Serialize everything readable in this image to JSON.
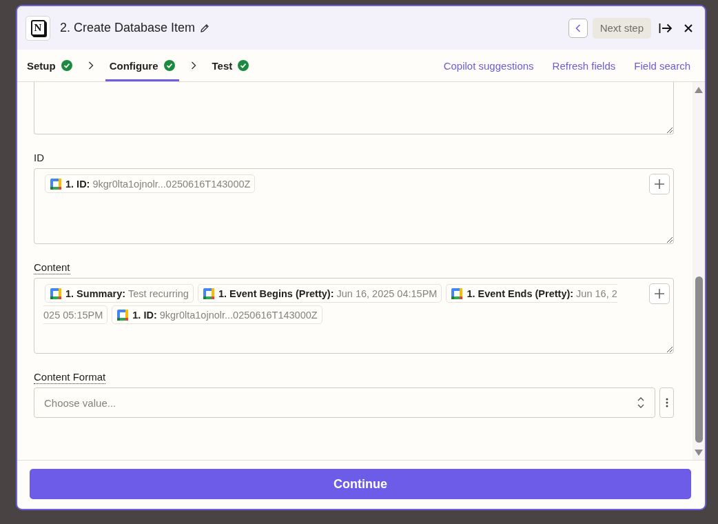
{
  "header": {
    "logo_text": "N",
    "title": "2. Create Database Item",
    "next_button": {
      "label": "Next step",
      "disabled": true
    }
  },
  "steps": [
    {
      "label": "Setup",
      "done": true,
      "selected": false
    },
    {
      "label": "Configure",
      "done": true,
      "selected": true
    },
    {
      "label": "Test",
      "done": true,
      "selected": false
    }
  ],
  "links": [
    "Copilot suggestions",
    "Refresh fields",
    "Field search"
  ],
  "fields": [
    {
      "kind": "textarea",
      "cut_top": true
    },
    {
      "kind": "textarea",
      "cut_top": false,
      "label": "ID",
      "has_tooltip": false,
      "token_lines": [
        [
          {
            "kind": "whole",
            "label": "1. ID:",
            "value": "9kgr0lta1ojnolr...0250616T143000Z"
          }
        ]
      ]
    },
    {
      "kind": "textarea",
      "cut_top": false,
      "label": "Content",
      "has_tooltip": true,
      "token_lines": [
        [
          {
            "kind": "whole",
            "label": "1. Summary:",
            "value": "Test recurring"
          },
          {
            "kind": "whole",
            "label": "1. Event Begins (Pretty):",
            "value": "Jun 16, 2025 04:15PM"
          },
          {
            "kind": "cut_end",
            "label": "1. Event Ends (Pretty):",
            "value": "Jun 16, 2"
          }
        ],
        [
          {
            "kind": "cut_start",
            "value": "025 05:15PM"
          },
          {
            "kind": "whole",
            "label": "1. ID:",
            "value": "9kgr0lta1ojnolr...0250616T143000Z"
          }
        ]
      ]
    },
    {
      "kind": "select",
      "label": "Content Format",
      "has_tooltip": true,
      "placeholder": "Choose value..."
    }
  ],
  "footer": {
    "button": "Continue"
  }
}
